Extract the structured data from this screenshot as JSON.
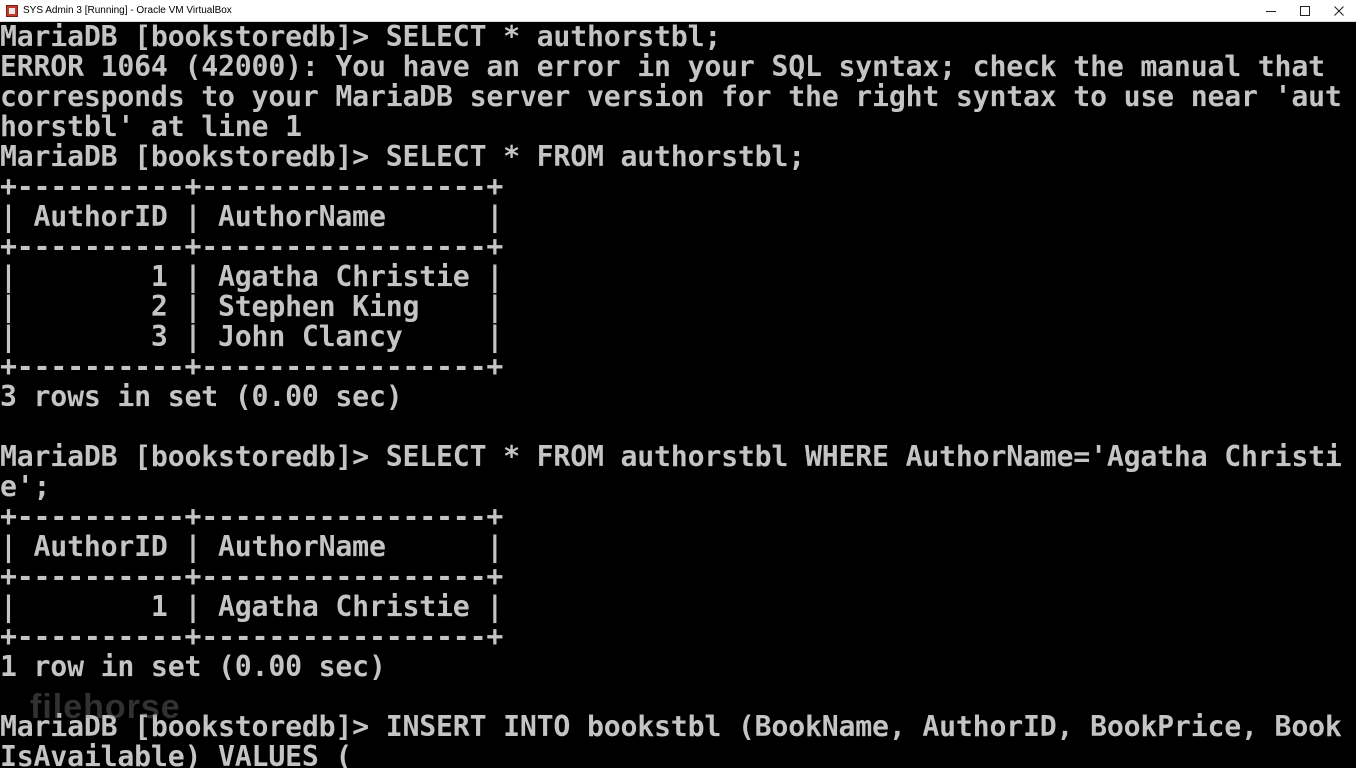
{
  "window": {
    "title": "SYS Admin 3 [Running] - Oracle VM VirtualBox",
    "controls": {
      "minimize": "minimize-icon",
      "maximize": "maximize-icon",
      "close": "close-icon"
    }
  },
  "terminal": {
    "foreground": "#c4c4c4",
    "background": "#000000",
    "lines": [
      "MariaDB [bookstoredb]> SELECT * authorstbl;",
      "ERROR 1064 (42000): You have an error in your SQL syntax; check the manual that",
      "corresponds to your MariaDB server version for the right syntax to use near 'aut",
      "horstbl' at line 1",
      "MariaDB [bookstoredb]> SELECT * FROM authorstbl;",
      "+----------+-----------------+",
      "| AuthorID | AuthorName      |",
      "+----------+-----------------+",
      "|        1 | Agatha Christie |",
      "|        2 | Stephen King    |",
      "|        3 | John Clancy     |",
      "+----------+-----------------+",
      "3 rows in set (0.00 sec)",
      "",
      "MariaDB [bookstoredb]> SELECT * FROM authorstbl WHERE AuthorName='Agatha Christi",
      "e';",
      "+----------+-----------------+",
      "| AuthorID | AuthorName      |",
      "+----------+-----------------+",
      "|        1 | Agatha Christie |",
      "+----------+-----------------+",
      "1 row in set (0.00 sec)",
      "",
      "MariaDB [bookstoredb]> INSERT INTO bookstbl (BookName, AuthorID, BookPrice, Book",
      "IsAvailable) VALUES (_"
    ]
  },
  "watermark": "filehorse"
}
